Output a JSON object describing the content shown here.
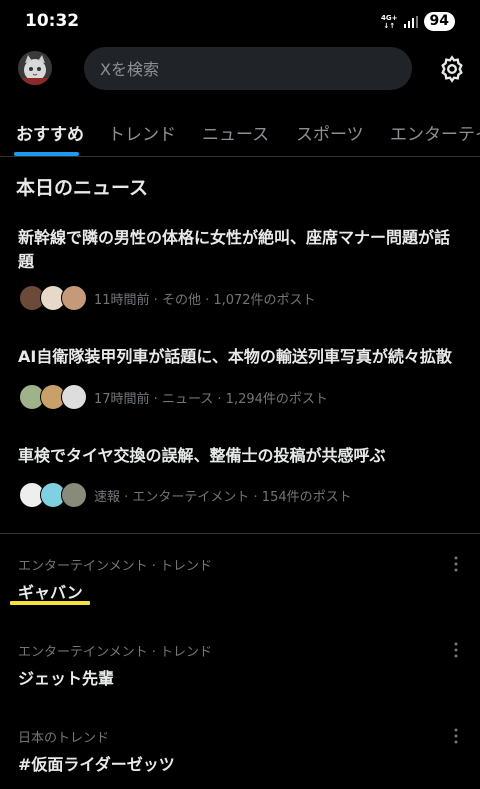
{
  "status": {
    "time": "10:32",
    "network_top": "4G+",
    "battery": "94"
  },
  "search": {
    "placeholder": "Xを検索"
  },
  "tabs": [
    "おすすめ",
    "トレンド",
    "ニュース",
    "スポーツ",
    "エンターテイ"
  ],
  "news_section": {
    "title": "本日のニュース",
    "items": [
      {
        "headline": "新幹線で隣の男性の体格に女性が絶叫、座席マナー問題が話題",
        "meta": "11時間前 · その他 · 1,072件のポスト"
      },
      {
        "headline": "AI自衛隊装甲列車が話題に、本物の輸送列車写真が続々拡散",
        "meta": "17時間前 · ニュース · 1,294件のポスト"
      },
      {
        "headline": "車検でタイヤ交換の誤解、整備士の投稿が共感呼ぶ",
        "meta": "速報 · エンターテイメント · 154件のポスト"
      }
    ]
  },
  "trends": [
    {
      "category": "エンターテインメント · トレンド",
      "title": "ギャバン"
    },
    {
      "category": "エンターテインメント · トレンド",
      "title": "ジェット先輩"
    },
    {
      "category": "日本のトレンド",
      "title": "#仮面ライダーゼッツ"
    }
  ],
  "colors": {
    "accent": "#1d9bf0",
    "highlight": "#f5e23c",
    "background": "#000000",
    "secondary_text": "#71767b"
  },
  "icons": [
    "profile-avatar",
    "gear-icon",
    "more-vertical-icon",
    "signal-icon"
  ]
}
